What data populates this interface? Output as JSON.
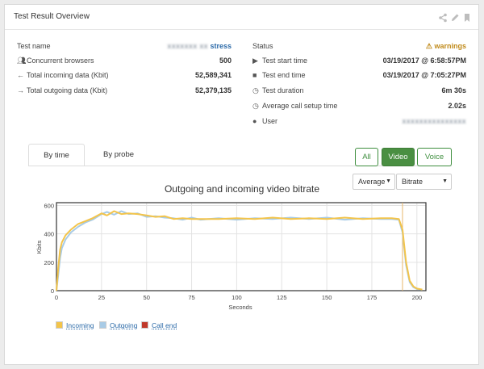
{
  "panel": {
    "title": "Test Result Overview",
    "icons": [
      "share-icon",
      "pencil-icon",
      "bookmark-icon"
    ]
  },
  "left_rows": [
    {
      "icon": "",
      "label": "Test name",
      "value_blurred": "xxxxxxx xx",
      "value": "stress"
    },
    {
      "icon": "users-icon",
      "label": "Concurrent browsers",
      "value": "500"
    },
    {
      "icon": "arrow-left-icon",
      "label": "Total incoming data (Kbit)",
      "value": "52,589,341"
    },
    {
      "icon": "arrow-right-icon",
      "label": "Total outgoing data (Kbit)",
      "value": "52,379,135"
    }
  ],
  "right_rows": [
    {
      "icon": "",
      "label": "Status",
      "value": "warnings"
    },
    {
      "icon": "play-icon",
      "label": "Test start time",
      "value": "03/19/2017 @ 6:58:57PM"
    },
    {
      "icon": "stop-icon",
      "label": "Test end time",
      "value": "03/19/2017 @ 7:05:27PM"
    },
    {
      "icon": "clock-icon",
      "label": "Test duration",
      "value": "6m 30s"
    },
    {
      "icon": "clock-icon",
      "label": "Average call setup time",
      "value": "2.02s"
    },
    {
      "icon": "user-icon",
      "label": "User",
      "value_blurred": "xxxxxxxxxxxxxxx"
    }
  ],
  "tabs": [
    "By time",
    "By probe"
  ],
  "filter_buttons": [
    "All",
    "Video",
    "Voice"
  ],
  "active_filter": "Video",
  "selects": [
    {
      "value": "Average"
    },
    {
      "value": "Bitrate"
    }
  ],
  "colors": {
    "incoming": "#f3c44a",
    "outgoing": "#a8cbe6",
    "call_end": "#c0392b",
    "accent_green": "#4a8f42",
    "link_blue": "#2b6aa8",
    "warning": "#c08a1a"
  },
  "chart_data": {
    "type": "line",
    "title": "Outgoing and incoming video bitrate",
    "xlabel": "Seconds",
    "ylabel": "Kbits",
    "xlim": [
      0,
      205
    ],
    "ylim": [
      0,
      620
    ],
    "xticks": [
      0,
      25,
      50,
      75,
      100,
      125,
      150,
      175,
      200
    ],
    "yticks": [
      0,
      200,
      400,
      600
    ],
    "grid": true,
    "legend_placement": "bottom-left",
    "call_end_x": 192,
    "series": [
      {
        "name": "Incoming",
        "x": [
          0,
          1,
          2,
          3,
          5,
          8,
          12,
          16,
          20,
          25,
          28,
          32,
          36,
          40,
          45,
          50,
          55,
          60,
          65,
          70,
          75,
          80,
          90,
          100,
          110,
          120,
          130,
          140,
          150,
          160,
          170,
          180,
          186,
          190,
          192,
          194,
          196,
          198,
          200,
          203
        ],
        "y": [
          0,
          160,
          290,
          340,
          390,
          430,
          470,
          490,
          510,
          545,
          530,
          560,
          540,
          545,
          540,
          530,
          520,
          525,
          505,
          510,
          505,
          505,
          505,
          510,
          505,
          515,
          505,
          510,
          505,
          515,
          505,
          510,
          510,
          505,
          430,
          200,
          70,
          30,
          15,
          8
        ]
      },
      {
        "name": "Outgoing",
        "x": [
          0,
          1,
          2,
          3,
          5,
          8,
          12,
          16,
          20,
          25,
          28,
          32,
          36,
          40,
          45,
          50,
          55,
          60,
          65,
          70,
          75,
          80,
          90,
          100,
          110,
          120,
          130,
          140,
          150,
          160,
          170,
          180,
          186,
          190,
          192,
          194,
          196,
          198,
          200,
          203
        ],
        "y": [
          0,
          110,
          230,
          300,
          360,
          410,
          450,
          480,
          500,
          540,
          555,
          535,
          560,
          540,
          545,
          520,
          525,
          515,
          510,
          500,
          515,
          500,
          510,
          500,
          510,
          505,
          515,
          505,
          515,
          500,
          510,
          505,
          505,
          500,
          410,
          180,
          60,
          25,
          12,
          6
        ]
      }
    ]
  }
}
